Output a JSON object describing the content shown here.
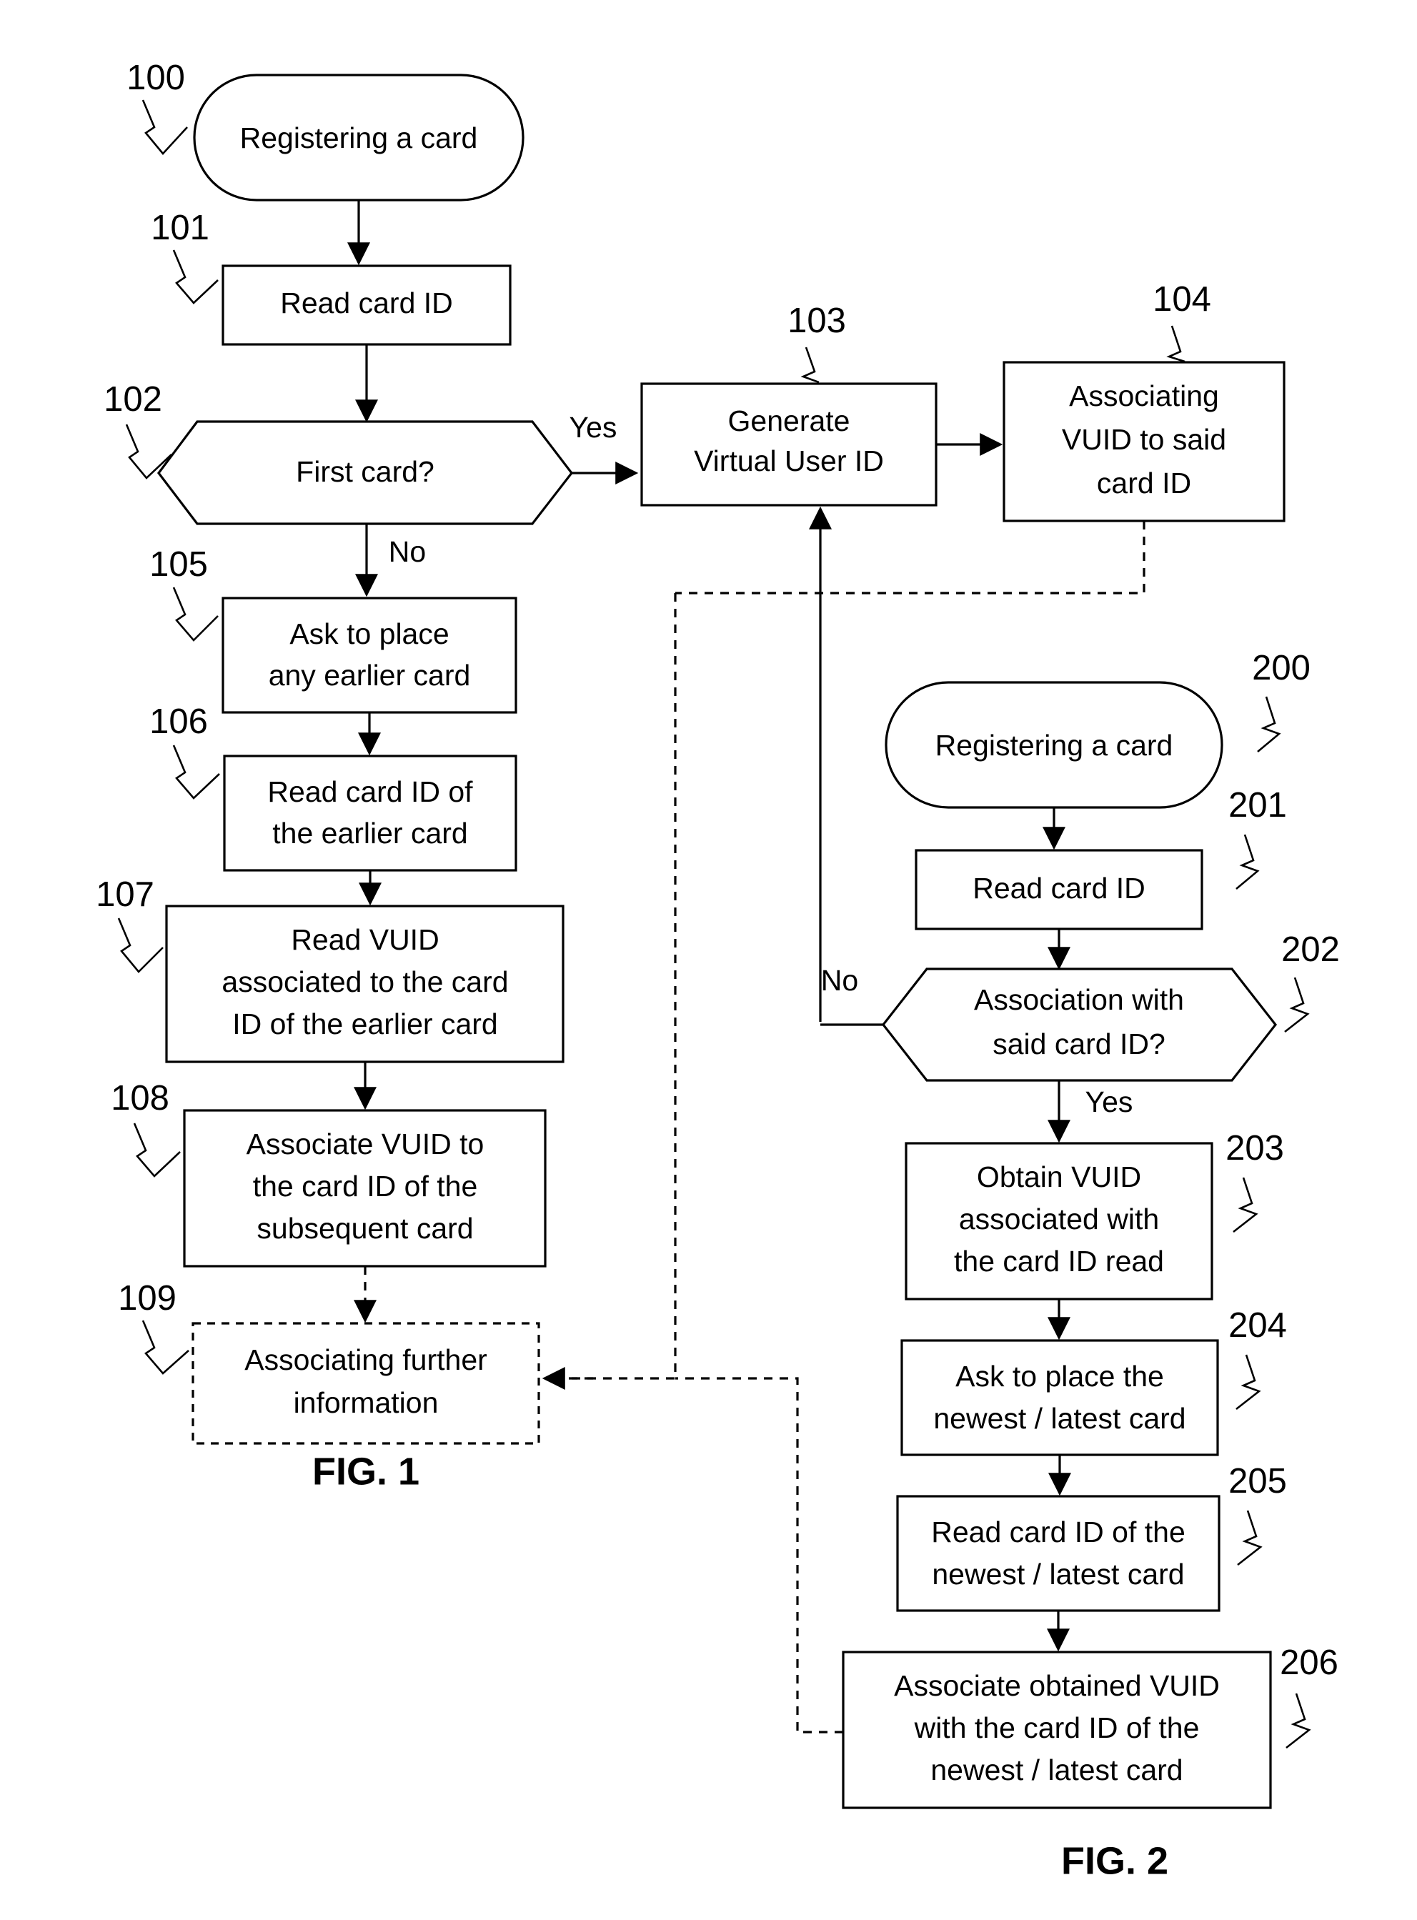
{
  "figures": [
    {
      "id": "fig1",
      "label": "FIG. 1",
      "nodes": [
        {
          "ref": "100",
          "shape": "terminator",
          "lines": [
            "Registering a card"
          ]
        },
        {
          "ref": "101",
          "shape": "process",
          "lines": [
            "Read card ID"
          ]
        },
        {
          "ref": "102",
          "shape": "decision",
          "lines": [
            "First card?"
          ]
        },
        {
          "ref": "103",
          "shape": "process",
          "lines": [
            "Generate",
            "Virtual User ID"
          ]
        },
        {
          "ref": "104",
          "shape": "process",
          "lines": [
            "Associating",
            "VUID to said",
            "card ID"
          ]
        },
        {
          "ref": "105",
          "shape": "process",
          "lines": [
            "Ask to place",
            "any earlier card"
          ]
        },
        {
          "ref": "106",
          "shape": "process",
          "lines": [
            "Read card ID of",
            "the earlier card"
          ]
        },
        {
          "ref": "107",
          "shape": "process",
          "lines": [
            "Read VUID",
            "associated to the card",
            "ID of the earlier card"
          ]
        },
        {
          "ref": "108",
          "shape": "process",
          "lines": [
            "Associate VUID to",
            "the card ID of the",
            "subsequent card"
          ]
        },
        {
          "ref": "109",
          "shape": "process-optional",
          "lines": [
            "Associating further",
            "information"
          ]
        }
      ],
      "edge_labels": {
        "yes": "Yes",
        "no": "No"
      }
    },
    {
      "id": "fig2",
      "label": "FIG. 2",
      "nodes": [
        {
          "ref": "200",
          "shape": "terminator",
          "lines": [
            "Registering a card"
          ]
        },
        {
          "ref": "201",
          "shape": "process",
          "lines": [
            "Read card ID"
          ]
        },
        {
          "ref": "202",
          "shape": "decision",
          "lines": [
            "Association with",
            "said card ID?"
          ]
        },
        {
          "ref": "203",
          "shape": "process",
          "lines": [
            "Obtain VUID",
            "associated with",
            "the card ID read"
          ]
        },
        {
          "ref": "204",
          "shape": "process",
          "lines": [
            "Ask to place the",
            "newest / latest card"
          ]
        },
        {
          "ref": "205",
          "shape": "process",
          "lines": [
            "Read card ID of the",
            "newest / latest card"
          ]
        },
        {
          "ref": "206",
          "shape": "process",
          "lines": [
            "Associate obtained VUID",
            "with the card ID of the",
            "newest / latest card"
          ]
        }
      ],
      "edge_labels": {
        "yes": "Yes",
        "no": "No"
      }
    }
  ],
  "text": {
    "n100_l1": "Registering a card",
    "n101_l1": "Read card ID",
    "n102_l1": "First card?",
    "n103_l1": "Generate",
    "n103_l2": "Virtual User ID",
    "n104_l1": "Associating",
    "n104_l2": "VUID to said",
    "n104_l3": "card ID",
    "n105_l1": "Ask to place",
    "n105_l2": "any earlier card",
    "n106_l1": "Read card ID of",
    "n106_l2": "the earlier card",
    "n107_l1": "Read VUID",
    "n107_l2": "associated to the card",
    "n107_l3": "ID of the earlier card",
    "n108_l1": "Associate VUID to",
    "n108_l2": "the card ID of the",
    "n108_l3": "subsequent card",
    "n109_l1": "Associating further",
    "n109_l2": "information",
    "n200_l1": "Registering a card",
    "n201_l1": "Read card ID",
    "n202_l1": "Association with",
    "n202_l2": "said card ID?",
    "n203_l1": "Obtain VUID",
    "n203_l2": "associated with",
    "n203_l3": "the card ID read",
    "n204_l1": "Ask to place the",
    "n204_l2": "newest / latest card",
    "n205_l1": "Read card ID of the",
    "n205_l2": "newest / latest card",
    "n206_l1": "Associate obtained VUID",
    "n206_l2": "with the card ID of the",
    "n206_l3": "newest / latest card",
    "ref_100": "100",
    "ref_101": "101",
    "ref_102": "102",
    "ref_103": "103",
    "ref_104": "104",
    "ref_105": "105",
    "ref_106": "106",
    "ref_107": "107",
    "ref_108": "108",
    "ref_109": "109",
    "ref_200": "200",
    "ref_201": "201",
    "ref_202": "202",
    "ref_203": "203",
    "ref_204": "204",
    "ref_205": "205",
    "ref_206": "206",
    "yes_102": "Yes",
    "no_102": "No",
    "yes_202": "Yes",
    "no_202": "No",
    "fig1_label": "FIG. 1",
    "fig2_label": "FIG. 2"
  },
  "colors": {
    "stroke": "#000000",
    "fill": "#ffffff",
    "background": "#ffffff"
  }
}
